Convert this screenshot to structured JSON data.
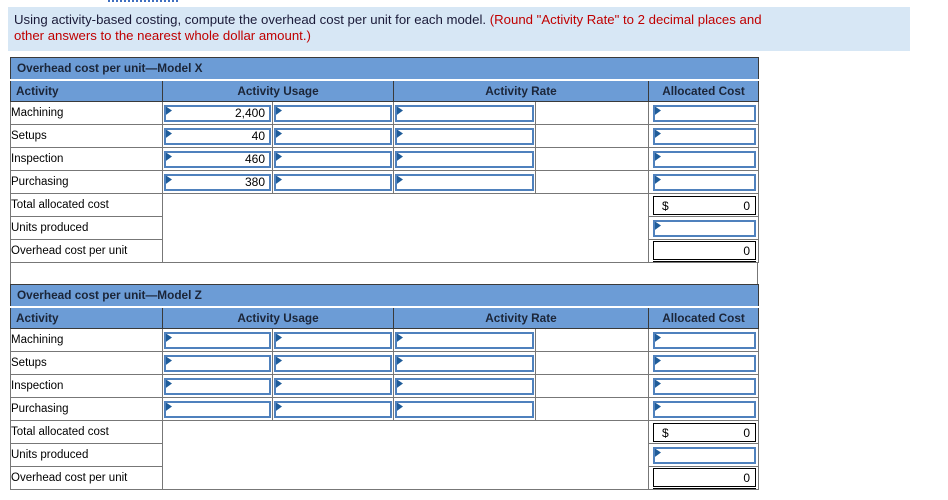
{
  "instruction": {
    "black": "Using activity-based costing, compute the overhead cost per unit for each model. ",
    "red1": "(Round \"Activity Rate\" to 2 decimal places and",
    "red2": "other answers to the nearest whole dollar amount.)"
  },
  "tables": [
    {
      "title": "Overhead cost per unit—Model X",
      "headers": {
        "activity": "Activity",
        "usage": "Activity Usage",
        "rate": "Activity Rate",
        "allocated": "Allocated Cost"
      },
      "rows": [
        {
          "label": "Machining",
          "usage": "2,400"
        },
        {
          "label": "Setups",
          "usage": "40"
        },
        {
          "label": "Inspection",
          "usage": "460"
        },
        {
          "label": "Purchasing",
          "usage": "380"
        }
      ],
      "total_label": "Total allocated cost",
      "total_currency": "$",
      "total_value": "0",
      "units_label": "Units produced",
      "per_unit_label": "Overhead cost per unit",
      "per_unit_value": "0"
    },
    {
      "title": "Overhead cost per unit—Model Z",
      "headers": {
        "activity": "Activity",
        "usage": "Activity Usage",
        "rate": "Activity Rate",
        "allocated": "Allocated Cost"
      },
      "rows": [
        {
          "label": "Machining",
          "usage": ""
        },
        {
          "label": "Setups",
          "usage": ""
        },
        {
          "label": "Inspection",
          "usage": ""
        },
        {
          "label": "Purchasing",
          "usage": ""
        }
      ],
      "total_label": "Total allocated cost",
      "total_currency": "$",
      "total_value": "0",
      "units_label": "Units produced",
      "per_unit_label": "Overhead cost per unit",
      "per_unit_value": "0"
    }
  ],
  "colors": {
    "header_blue": "#6c9cd6",
    "input_border_blue": "#4f81bd",
    "flag_blue": "#1f5c99",
    "note_red": "#c00000",
    "instruction_bg": "#d7e7f5"
  }
}
